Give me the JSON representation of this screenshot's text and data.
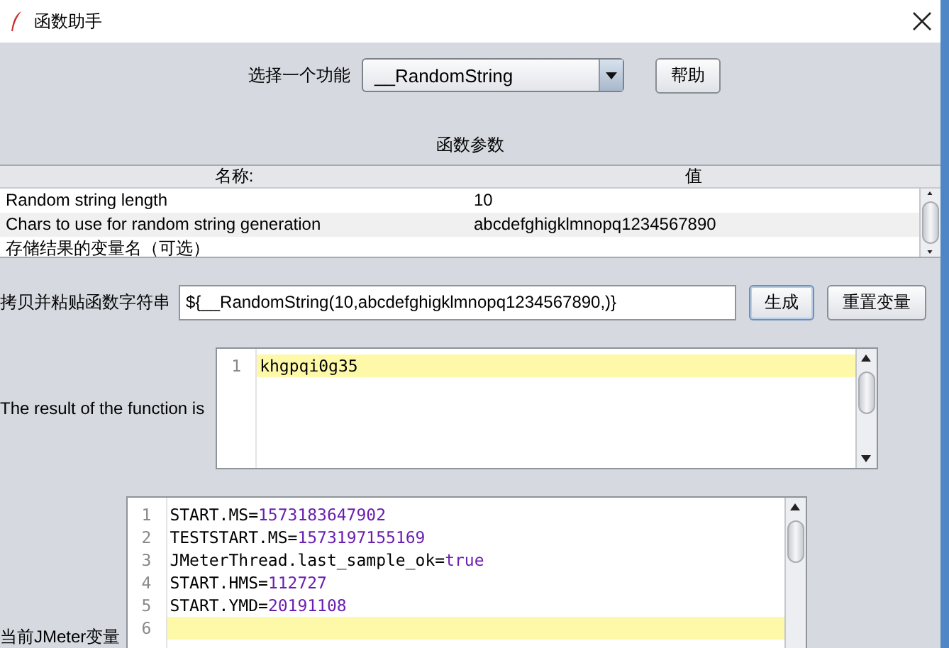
{
  "window": {
    "title": "函数助手"
  },
  "function_select": {
    "label": "选择一个功能",
    "value": "__RandomString",
    "help_button": "帮助"
  },
  "parameters": {
    "title": "函数参数",
    "columns": [
      "名称:",
      "值"
    ],
    "rows": [
      {
        "name": "Random string length",
        "value": "10"
      },
      {
        "name": "Chars to use for random string generation",
        "value": "abcdefghigklmnopq1234567890"
      },
      {
        "name": "存储结果的变量名（可选）"
      }
    ]
  },
  "copy": {
    "label": "拷贝并粘贴函数字符串",
    "value": "${__RandomString(10,abcdefghigklmnopq1234567890,)}",
    "buttons": [
      {
        "label": "生成",
        "focused": true
      },
      {
        "label": "重置变量",
        "focused": false
      }
    ]
  },
  "result": {
    "label": "The result of the function is",
    "lines": [
      {
        "number": "1",
        "text": "khgpqi0g35",
        "highlighted": true
      }
    ]
  },
  "variables": {
    "label": "当前JMeter变量",
    "lines": [
      {
        "number": "1",
        "name": "START.MS=",
        "value": "1573183647902",
        "highlighted": false
      },
      {
        "number": "2",
        "name": "TESTSTART.MS=",
        "value": "1573197155169",
        "highlighted": false
      },
      {
        "number": "3",
        "name": "JMeterThread.last_sample_ok=",
        "value": "true",
        "highlighted": false
      },
      {
        "number": "4",
        "name": "START.HMS=",
        "value": "112727",
        "highlighted": false
      },
      {
        "number": "5",
        "name": "START.YMD=",
        "value": "20191108",
        "highlighted": false
      },
      {
        "number": "6",
        "highlighted": true
      }
    ]
  }
}
